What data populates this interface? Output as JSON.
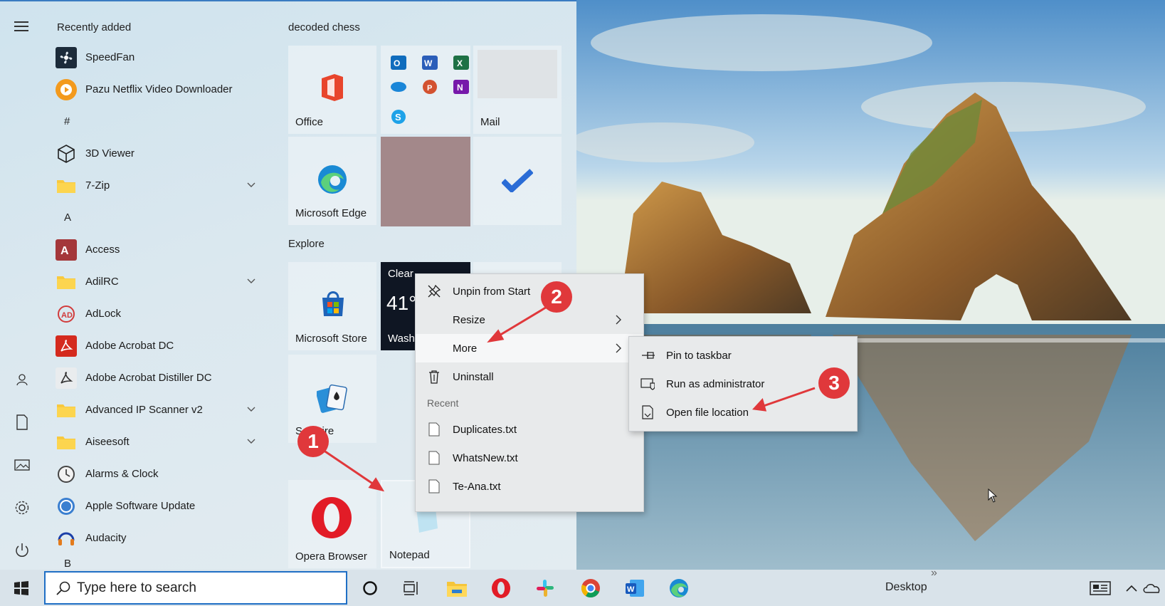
{
  "app_list": {
    "recently_added": "Recently added",
    "recent_apps": [
      {
        "label": "SpeedFan",
        "icon": "fan-icon"
      },
      {
        "label": "Pazu Netflix Video Downloader",
        "icon": "play-icon"
      }
    ],
    "letter_hash": "#",
    "hash_apps": [
      {
        "label": "3D Viewer",
        "icon": "cube-icon"
      },
      {
        "label": "7-Zip",
        "icon": "folder-icon"
      }
    ],
    "letter_a": "A",
    "a_apps": [
      {
        "label": "Access",
        "icon": "access-icon"
      },
      {
        "label": "AdilRC",
        "icon": "folder-icon"
      },
      {
        "label": "AdLock",
        "icon": "adlock-icon"
      },
      {
        "label": "Adobe Acrobat DC",
        "icon": "acrobat-icon"
      },
      {
        "label": "Adobe Acrobat Distiller DC",
        "icon": "distiller-icon"
      },
      {
        "label": "Advanced IP Scanner v2",
        "icon": "folder-icon"
      },
      {
        "label": "Aiseesoft",
        "icon": "folder-icon"
      },
      {
        "label": "Alarms & Clock",
        "icon": "clock-icon"
      },
      {
        "label": "Apple Software Update",
        "icon": "apple-update-icon"
      },
      {
        "label": "Audacity",
        "icon": "audacity-icon"
      }
    ],
    "letter_b": "B"
  },
  "tiles": {
    "group1_title": "decoded chess",
    "office": "Office",
    "mail": "Mail",
    "edge": "Microsoft Edge",
    "group2_title": "Explore",
    "store": "Microsoft Store",
    "weather_condition": "Clear",
    "weather_temp": "41°",
    "weather_city": "Washi",
    "solitaire": "Solitaire",
    "opera": "Opera Browser",
    "notepad": "Notepad"
  },
  "context_menu": {
    "unpin": "Unpin from Start",
    "resize": "Resize",
    "more": "More",
    "uninstall": "Uninstall",
    "recent_header": "Recent",
    "recent_files": [
      "Duplicates.txt",
      "WhatsNew.txt",
      "Te-Ana.txt"
    ]
  },
  "submenu": {
    "pin_taskbar": "Pin to taskbar",
    "run_admin": "Run as administrator",
    "open_location": "Open file location"
  },
  "badges": [
    "1",
    "2",
    "3"
  ],
  "taskbar": {
    "search_placeholder": "Type here to search",
    "desktop_label": "Desktop",
    "overflow": "»"
  },
  "colors": {
    "accent": "#1f6fc5",
    "badge": "#e0383b"
  }
}
